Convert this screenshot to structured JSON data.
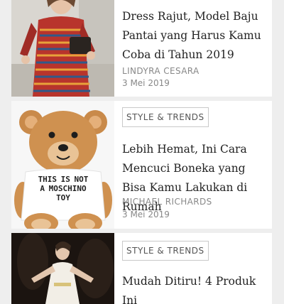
{
  "articles": [
    {
      "image_alt": "woman in colorful crochet knit dress",
      "title": "Dress Rajut, Model Baju Pantai yang Harus Kamu Coba di Tahun 2019",
      "author": "LINDYRA CESARA",
      "date": "3 Mei 2019"
    },
    {
      "image_alt": "teddy bear wearing Moschino t-shirt",
      "shirt_text": "THIS IS NOT A MOSCHINO TOY",
      "category": "STYLE & TRENDS",
      "title": "Lebih Hemat, Ini Cara Mencuci Boneka yang Bisa Kamu Lakukan di Rumah",
      "author": "MICHAEL RICHARDS",
      "date": "3 Mei 2019"
    },
    {
      "image_alt": "woman in white gown on dark background",
      "category": "STYLE & TRENDS",
      "title": "Mudah Ditiru! 4 Produk Ini"
    }
  ],
  "colors": {
    "background": "#eeeeee",
    "card": "#ffffff",
    "tag_border": "#c9c9c9",
    "meta_text": "#888888"
  }
}
